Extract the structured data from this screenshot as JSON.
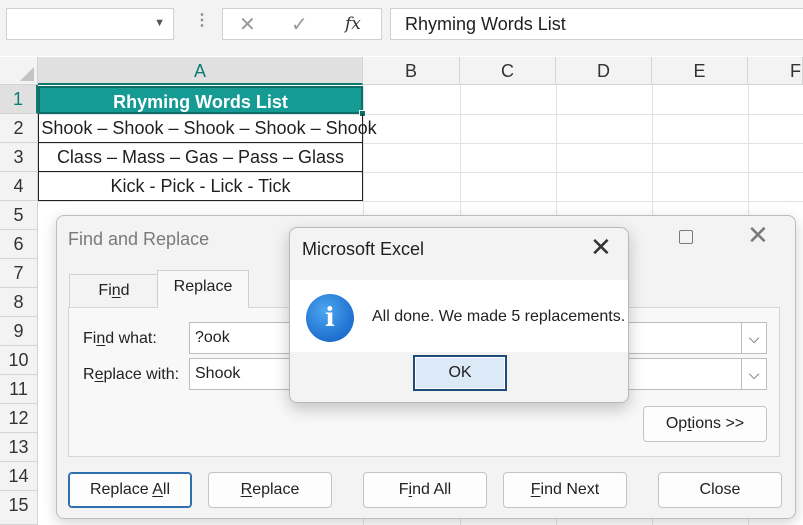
{
  "formula_bar": {
    "name_box": "",
    "cancel_icon": "✕",
    "enter_icon": "✓",
    "fx_label": "fx",
    "content": "Rhyming Words List"
  },
  "columns": [
    "A",
    "B",
    "C",
    "D",
    "E",
    "F"
  ],
  "rows": [
    "1",
    "2",
    "3",
    "4",
    "5",
    "6",
    "7",
    "8",
    "9",
    "10",
    "11",
    "12",
    "13",
    "14",
    "15"
  ],
  "cells": {
    "A1": "Rhyming Words List",
    "A2": "Shook – Shook – Shook – Shook – Shook",
    "A3": "Class – Mass – Gas – Pass – Glass",
    "A4": "Kick - Pick - Lick - Tick"
  },
  "colors": {
    "header_fill": "#159a94",
    "selection_accent": "#0e7a74",
    "ok_button_fill": "#dce9f7",
    "info_icon": "#1e6fcf"
  },
  "find_replace": {
    "title": "Find and Replace",
    "tabs": [
      {
        "label_pre": "Fi",
        "label_key": "n",
        "label_post": "d"
      },
      {
        "label_pre": "Re",
        "label_key": "p",
        "label_post": "lace"
      }
    ],
    "find_label": {
      "pre": "Fi",
      "key": "n",
      "post": "d what:"
    },
    "find_value": "?ook",
    "replace_label": {
      "pre": "R",
      "key": "e",
      "post": "place with:"
    },
    "replace_value": "Shook",
    "options_button": {
      "pre": "Op",
      "key": "t",
      "post": "ions >>"
    },
    "buttons": {
      "replace_all": {
        "pre": "Replace ",
        "key": "A",
        "post": "ll"
      },
      "replace": {
        "pre": "",
        "key": "R",
        "post": "eplace"
      },
      "find_all": {
        "pre": "F",
        "key": "i",
        "post": "nd All"
      },
      "find_next": {
        "pre": "",
        "key": "F",
        "post": "ind Next"
      },
      "close": "Close"
    }
  },
  "message_box": {
    "title": "Microsoft Excel",
    "icon": "info-icon",
    "icon_glyph": "i",
    "message": "All done. We made 5 replacements.",
    "ok_label": "OK"
  }
}
